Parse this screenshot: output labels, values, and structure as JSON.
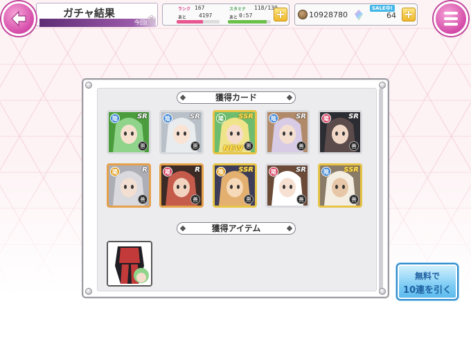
{
  "header": {
    "title": "ガチャ結果",
    "subtitle": "今回(",
    "rank_label": "ランク",
    "rank_value": "167",
    "rank_next_label": "あと",
    "rank_next_value": "4197",
    "rank_progress": 0.62,
    "stamina_label": "スタミナ",
    "stamina_value": "118/130",
    "stamina_next_label": "あと",
    "stamina_next_value": "0:57",
    "stamina_progress": 0.91,
    "coins": "10928780",
    "sale_badge": "SALE中!",
    "gems": "64"
  },
  "cards_section_label": "獲得カード",
  "items_section_label": "獲得アイテム",
  "cards": [
    {
      "rarity": "SR",
      "attr": "陰",
      "attr_color": "#3a84d6",
      "school": "悪",
      "new": "",
      "art": [
        "#8fd48a",
        "#4a9c3c",
        "#f6e1cf"
      ]
    },
    {
      "rarity": "SR",
      "attr": "陰",
      "attr_color": "#3a84d6",
      "school": "悪",
      "new": "",
      "art": [
        "#e9ecef",
        "#b9c0c8",
        "#f8e3d5"
      ]
    },
    {
      "rarity": "SSR",
      "attr": "陽",
      "attr_color": "#4aa84a",
      "school": "悪",
      "new": "NEW",
      "art": [
        "#f0e48a",
        "#6ebd6e",
        "#f6dccb"
      ]
    },
    {
      "rarity": "SR",
      "attr": "陰",
      "attr_color": "#3a84d6",
      "school": "善",
      "new": "",
      "art": [
        "#d8cbe6",
        "#b08a6a",
        "#f5dfd0"
      ]
    },
    {
      "rarity": "SR",
      "attr": "陽",
      "attr_color": "#d63a5a",
      "school": "善",
      "new": "",
      "art": [
        "#5b4b4b",
        "#2c2c33",
        "#f2d9c7"
      ]
    },
    {
      "rarity": "R",
      "attr": "陽",
      "attr_color": "#e0a020",
      "school": "善",
      "new": "",
      "art": [
        "#d9d9de",
        "#aeaeb6",
        "#f3dfd2"
      ]
    },
    {
      "rarity": "R",
      "attr": "陽",
      "attr_color": "#d63a5a",
      "school": "善",
      "new": "",
      "art": [
        "#c45b4b",
        "#3b2a25",
        "#f2d3bf"
      ]
    },
    {
      "rarity": "SSR",
      "attr": "陰",
      "attr_color": "#e0a020",
      "school": "悪",
      "new": "",
      "art": [
        "#e3b070",
        "#3d3d5a",
        "#f6d9b8"
      ]
    },
    {
      "rarity": "SR",
      "attr": "陽",
      "attr_color": "#d63a5a",
      "school": "善",
      "new": "",
      "art": [
        "#ffffff",
        "#6b4a38",
        "#f6e0d2"
      ]
    },
    {
      "rarity": "SSR",
      "attr": "陰",
      "attr_color": "#3a84d6",
      "school": "善",
      "new": "",
      "art": [
        "#f4eee2",
        "#8a7b68",
        "#e7c7a7"
      ]
    }
  ],
  "item": {
    "name": "",
    "art": [
      "#c23a3a",
      "#1e1e24",
      "#8fd48a"
    ]
  },
  "free_button": {
    "line1": "無料で",
    "line2": "10連を引く"
  },
  "colors": {
    "accent_pink": "#d44aa8",
    "panel_border": "#9a9aa0",
    "free_button": "#58b8ec"
  }
}
